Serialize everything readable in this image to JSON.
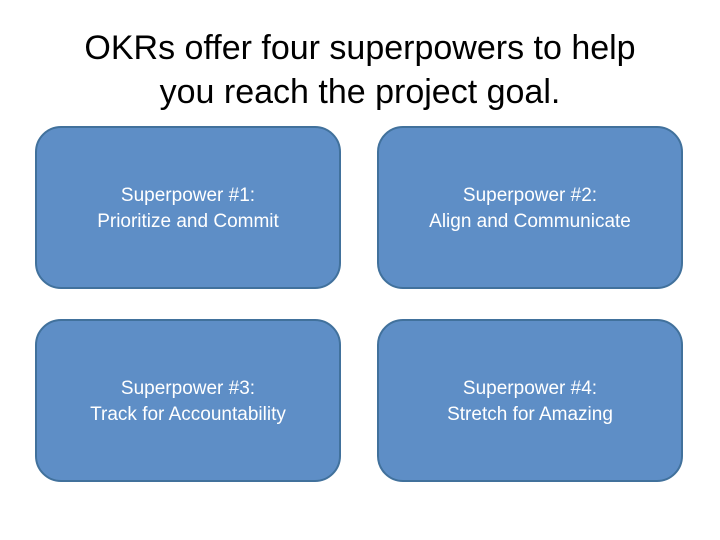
{
  "title": {
    "line1": "OKRs offer four superpowers to help",
    "line2": "you reach the project goal."
  },
  "superpowers": [
    {
      "heading": "Superpower #1:",
      "label": "Prioritize and Commit"
    },
    {
      "heading": "Superpower #2:",
      "label": "Align and Communicate"
    },
    {
      "heading": "Superpower #3:",
      "label": "Track for Accountability"
    },
    {
      "heading": "Superpower #4:",
      "label": "Stretch for Amazing"
    }
  ],
  "colors": {
    "box_fill": "#5e8ec6",
    "box_border": "#41719c",
    "box_text": "#ffffff",
    "title_text": "#000000"
  }
}
